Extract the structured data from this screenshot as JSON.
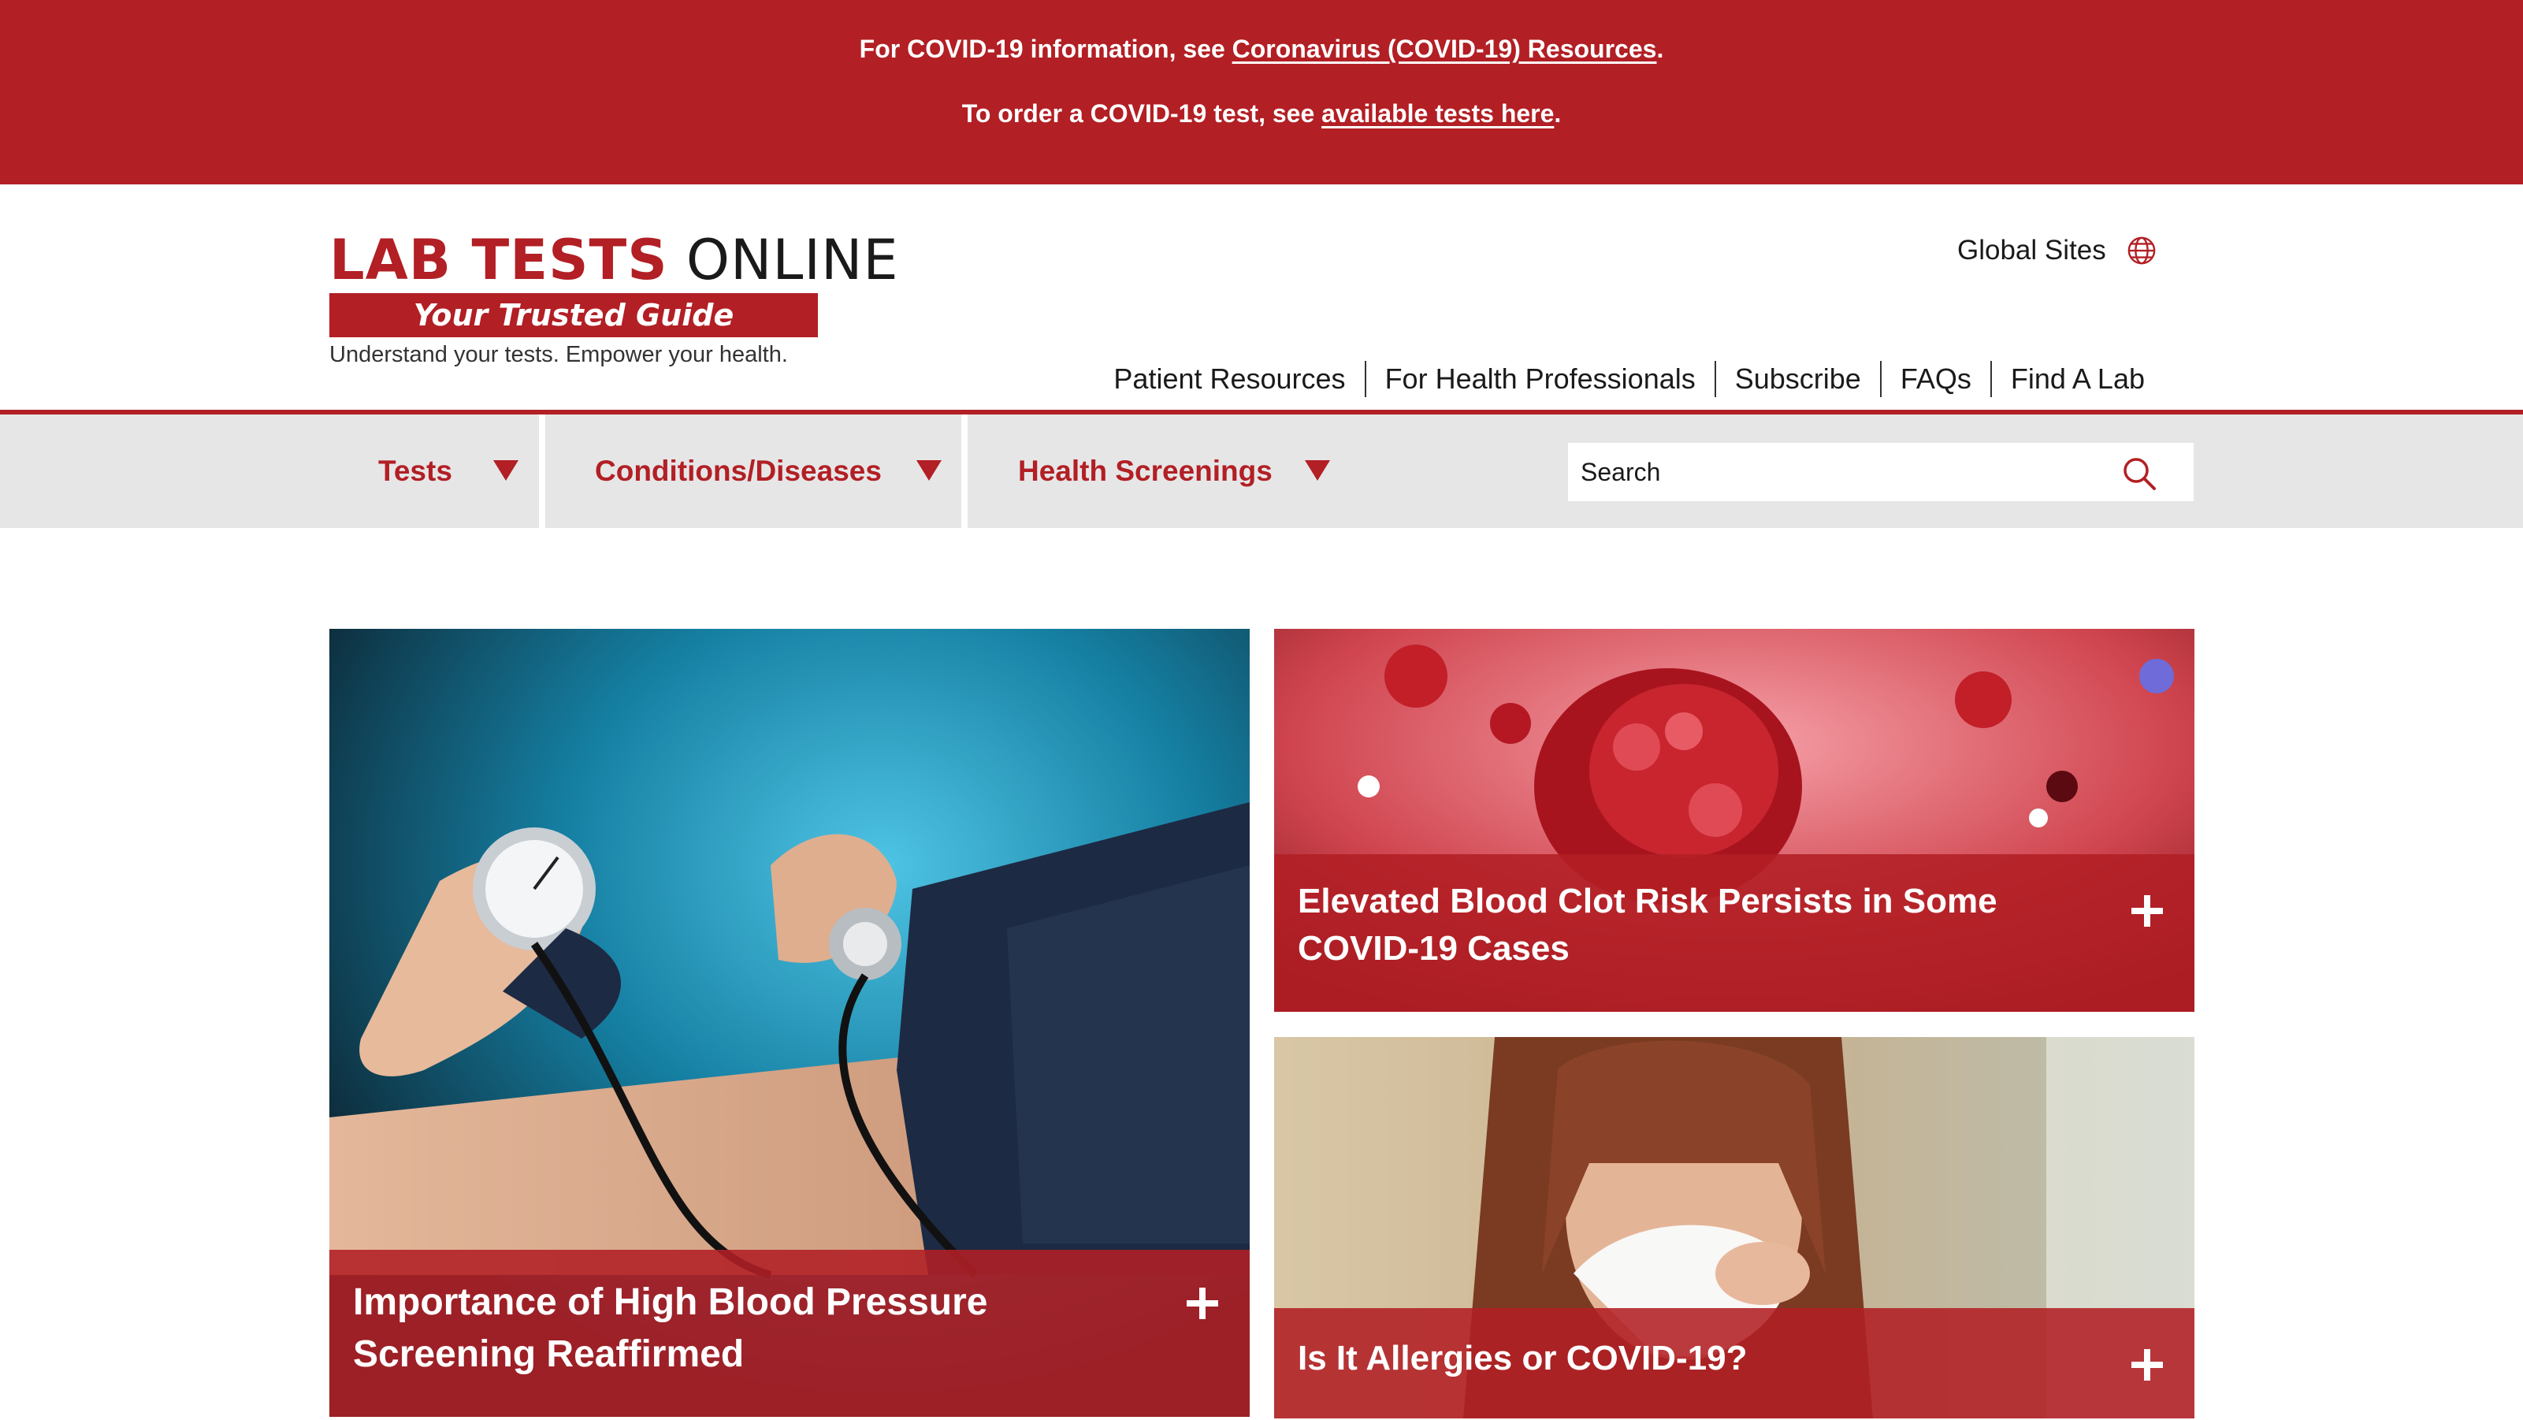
{
  "banner": {
    "line1_prefix": "For COVID-19 information, see ",
    "line1_link": "Coronavirus (COVID-19) Resources",
    "line1_suffix": ".",
    "line2_prefix": "To order a COVID-19 test, see ",
    "line2_link": "available tests here",
    "line2_suffix": "."
  },
  "logo": {
    "title_part1": "LAB TESTS",
    "title_part2": " ONLINE",
    "tagline": "Your Trusted Guide",
    "subtitle": "Understand your tests. Empower your health."
  },
  "header": {
    "global_sites": "Global Sites",
    "utility_nav": [
      "Patient Resources",
      "For Health Professionals",
      "Subscribe",
      "FAQs",
      "Find A Lab"
    ]
  },
  "main_nav": {
    "items": [
      "Tests",
      "Conditions/Diseases",
      "Health Screenings"
    ],
    "search_placeholder": "Search"
  },
  "cards": [
    {
      "title_line1": "Importance of High Blood Pressure",
      "title_line2": "Screening Reaffirmed",
      "image": "blood-pressure-measurement-photo"
    },
    {
      "title_line1": "Elevated Blood Clot Risk Persists in Some",
      "title_line2": "COVID-19 Cases",
      "image": "blood-clot-illustration"
    },
    {
      "title_line1": "Is It Allergies or COVID-19?",
      "title_line2": "",
      "image": "woman-sneezing-photo"
    }
  ],
  "colors": {
    "brand_red": "#b21f24",
    "nav_gray": "#e6e6e7"
  }
}
